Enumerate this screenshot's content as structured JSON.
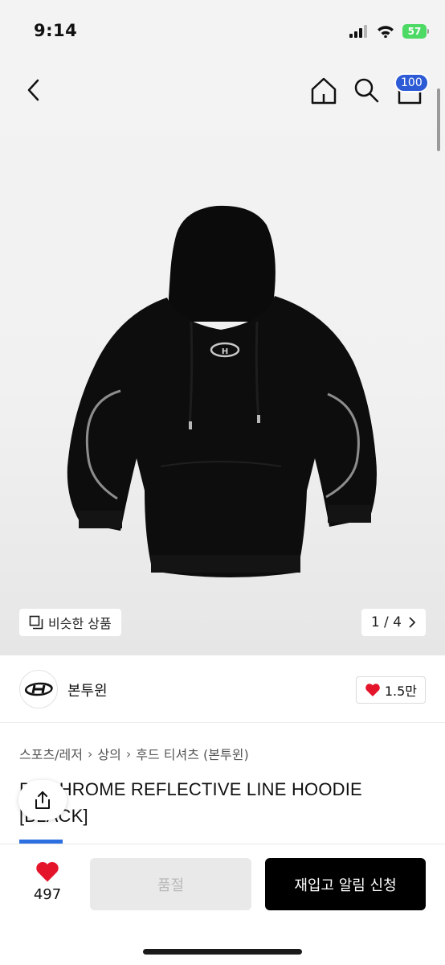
{
  "status": {
    "time": "9:14",
    "battery": "57"
  },
  "nav": {
    "cart_count": "100",
    "icons": [
      "back-icon",
      "home-icon",
      "search-icon",
      "cart-icon"
    ]
  },
  "gallery": {
    "similar_label": "비슷한 상품",
    "page_indicator": "1 / 4"
  },
  "brand": {
    "name": "본투윈",
    "likes": "1.5만"
  },
  "breadcrumb": [
    "스포츠/레저",
    "상의",
    "후드 티셔츠 (본투윈)"
  ],
  "product": {
    "title": "B2 CHROME REFLECTIVE LINE HOODIE [BLACK]"
  },
  "bottom": {
    "wish_count": "497",
    "soldout_label": "품절",
    "restock_label": "재입고 알림 신청"
  },
  "colors": {
    "accent_blue": "#2d5bd6",
    "heart_red": "#e4142b",
    "battery_green": "#4cd964"
  }
}
